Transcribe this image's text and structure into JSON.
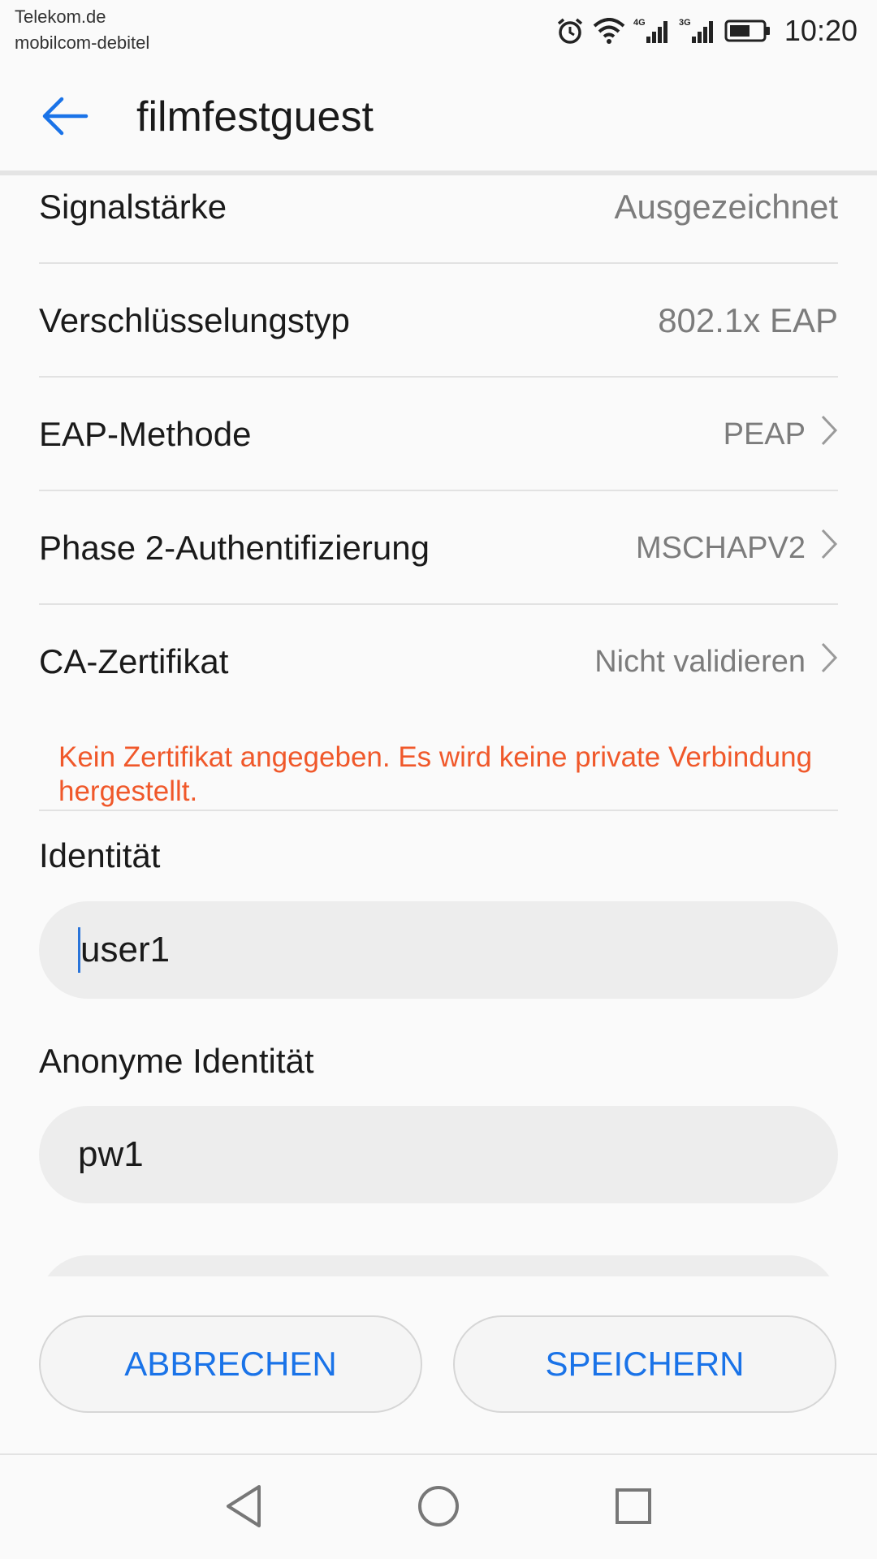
{
  "status_bar": {
    "carrier_line1": "Telekom.de",
    "carrier_line2": "mobilcom-debitel",
    "network1": "4G",
    "network2": "3G",
    "time": "10:20",
    "icons": [
      "alarm-icon",
      "wifi-icon",
      "signal-4g-icon",
      "signal-3g-icon",
      "battery-icon"
    ]
  },
  "app_bar": {
    "title": "filmfestguest",
    "back_icon": "arrow-left-icon",
    "accent_color": "#1a73e8"
  },
  "rows": [
    {
      "label": "Signalstärke",
      "value": "Ausgezeichnet",
      "chevron": false
    },
    {
      "label": "Verschlüsselungstyp",
      "value": "802.1x EAP",
      "chevron": false
    },
    {
      "label": "EAP-Methode",
      "value": "PEAP",
      "chevron": true
    },
    {
      "label": "Phase 2-Authentifizierung",
      "value": "MSCHAPV2",
      "chevron": true
    },
    {
      "label": "CA-Zertifikat",
      "value": "Nicht validieren",
      "chevron": true
    }
  ],
  "warning": {
    "text": "Kein Zertifikat angegeben. Es wird keine private Verbindung hergestellt.",
    "color": "#f0582a"
  },
  "fields": {
    "identity": {
      "label": "Identität",
      "value": "user1"
    },
    "anonymous_identity": {
      "label": "Anonyme Identität",
      "value": "pw1"
    }
  },
  "buttons": {
    "cancel": "ABBRECHEN",
    "save": "SPEICHERN"
  },
  "nav_bar": {
    "icons": [
      "back-triangle-icon",
      "home-circle-icon",
      "recents-square-icon"
    ]
  }
}
